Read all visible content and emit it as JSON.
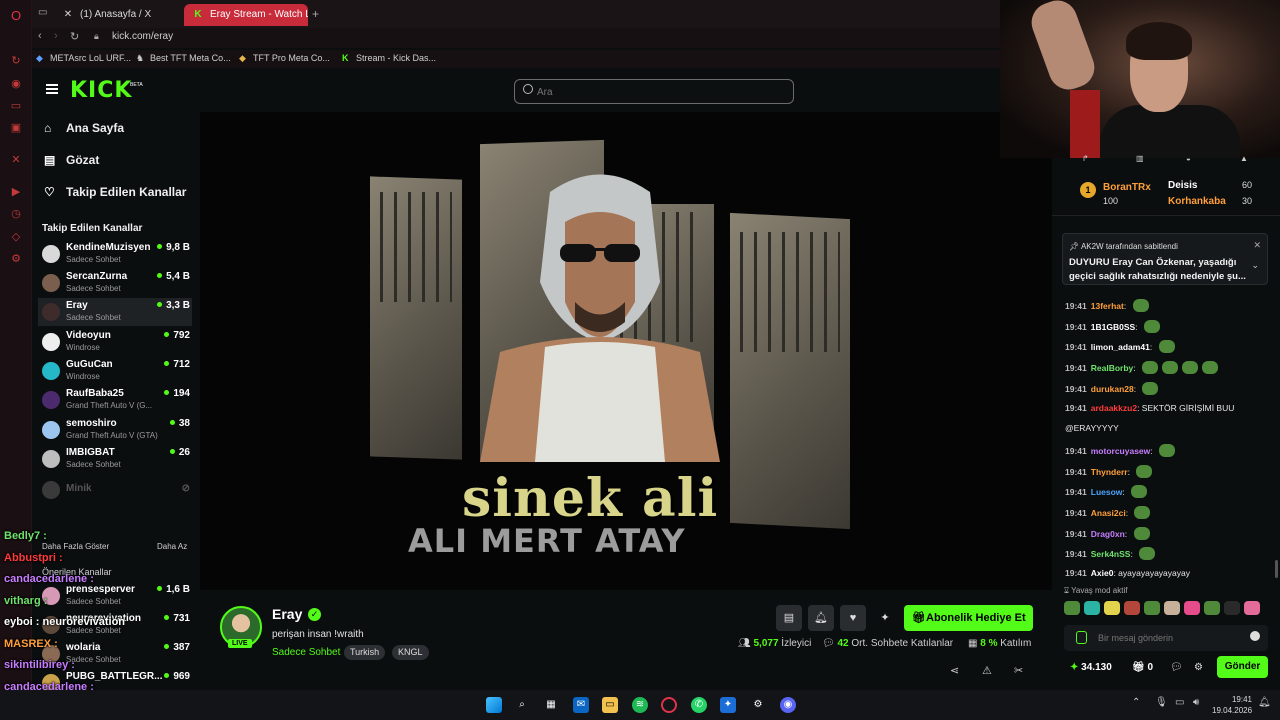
{
  "browser": {
    "tabs": [
      {
        "label": "(1) Anasayfa / X",
        "icon": "x-logo-icon"
      },
      {
        "label": "Eray Stream - Watch L",
        "icon": "kick-logo-icon"
      }
    ],
    "url": "kick.com/eray",
    "bookmarks": [
      "METAsrc LoL URF...",
      "Best TFT Meta Co...",
      "TFT Pro Meta Co...",
      "Stream - Kick Das..."
    ]
  },
  "kick": {
    "logo": "KICK",
    "beta": "BETA",
    "search_placeholder": "Ara",
    "nav": [
      "Ana Sayfa",
      "Gözat",
      "Takip Edilen Kanallar"
    ]
  },
  "sidebar": {
    "followed_title": "Takip Edilen Kanallar",
    "channels": [
      {
        "name": "KendineMuzisyen",
        "category": "Sadece Sohbet",
        "viewers": "9,8 B"
      },
      {
        "name": "SercanZurna",
        "category": "Sadece Sohbet",
        "viewers": "5,4 B"
      },
      {
        "name": "Eray",
        "category": "Sadece Sohbet",
        "viewers": "3,3 B"
      },
      {
        "name": "Videoyun",
        "category": "Windrose",
        "viewers": "792"
      },
      {
        "name": "GuGuCan",
        "category": "Windrose",
        "viewers": "712"
      },
      {
        "name": "RaufBaba25",
        "category": "Grand Theft Auto V (G...",
        "viewers": "194"
      },
      {
        "name": "semoshiro",
        "category": "Grand Theft Auto V (GTA)",
        "viewers": "38"
      },
      {
        "name": "IMBIGBAT",
        "category": "Sadece Sohbet",
        "viewers": "26"
      },
      {
        "name": "Minik",
        "category": "",
        "viewers": ""
      }
    ],
    "show_more": "Daha Fazla Göster",
    "show_less": "Daha Az",
    "recommended_title": "Önerilen Kanallar",
    "recommended": [
      {
        "name": "prensesperver",
        "category": "Sadece Sohbet",
        "viewers": "1,6 B"
      },
      {
        "name": "neurorevivation",
        "category": "Sadece Sohbet",
        "viewers": "731"
      },
      {
        "name": "wolaria",
        "category": "Sadece Sohbet",
        "viewers": "387"
      },
      {
        "name": "PUBG_BATTLEGR...",
        "category": "",
        "viewers": "969"
      }
    ]
  },
  "stream_overlay_chat": [
    {
      "text": "Bedly7 :",
      "color": "#6fe36b"
    },
    {
      "text": "Abbustpri :",
      "color": "#ff3b3b"
    },
    {
      "text": "candacedarlene :",
      "color": "#c77dff"
    },
    {
      "text": "vitharg :",
      "color": "#6fe36b"
    },
    {
      "text": "eyboi : neurorevivation",
      "color": "#ffffff"
    },
    {
      "text": "MASREX :",
      "color": "#ff9f3b"
    },
    {
      "text": "sikintilibirey :",
      "color": "#c77dff"
    },
    {
      "text": "candacedarlene :",
      "color": "#c77dff"
    }
  ],
  "video": {
    "title_line1": "sinek ali",
    "title_line2": "ALI MERT ATAY"
  },
  "stream": {
    "streamer": "Eray",
    "live_badge": "LIVE",
    "title": "perişan insan !wraith",
    "category": "Sadece Sohbet",
    "tags": [
      "Turkish",
      "KNGL"
    ],
    "subscribe_label": "Abonelik Hediye Et",
    "viewers": "5,077",
    "viewers_label": "İzleyici",
    "chatters": "42",
    "chatters_label": "Ort. Sohbete Katılanlar",
    "participation": "8 %",
    "participation_label": "Katılım"
  },
  "chat": {
    "leaderboard": [
      {
        "name": "BoranTRx",
        "score": "100"
      },
      {
        "name": "Deisis",
        "score": "60"
      },
      {
        "name": "Korhankaba",
        "score": "30"
      }
    ],
    "pinned_by": "AK2W tarafından sabitlendi",
    "pinned_text": "DUYURU Eray Can Özkenar, yaşadığı geçici sağlık rahatsızlığı nedeniyle şu...",
    "messages": [
      {
        "time": "19:41",
        "user": "13ferhat",
        "text": "",
        "color": "#ff9f3b",
        "emotes": 1
      },
      {
        "time": "19:41",
        "user": "1B1GB0SS",
        "text": "",
        "color": "#ffffff",
        "emotes": 1
      },
      {
        "time": "19:41",
        "user": "limon_adam41",
        "text": "",
        "color": "#ffffff",
        "emotes": 1
      },
      {
        "time": "19:41",
        "user": "RealBorby",
        "text": "",
        "color": "#6fe36b",
        "emotes": 4
      },
      {
        "time": "19:41",
        "user": "durukan28",
        "text": "",
        "color": "#ff9f3b",
        "emotes": 1
      },
      {
        "time": "19:41",
        "user": "ardaakkzu2",
        "text": "SEKTÖR GİRİŞİMİ BUU",
        "color": "#ff3b3b",
        "emotes": 0
      },
      {
        "time": "",
        "user": "",
        "text": "@ERAYYYYY",
        "color": "#ffffff",
        "emotes": 0
      },
      {
        "time": "19:41",
        "user": "motorcuyasew",
        "text": "",
        "color": "#c77dff",
        "emotes": 1
      },
      {
        "time": "19:41",
        "user": "Thynderr",
        "text": "",
        "color": "#ff9f3b",
        "emotes": 1
      },
      {
        "time": "19:41",
        "user": "Luesow",
        "text": "",
        "color": "#4aa3ff",
        "emotes": 1
      },
      {
        "time": "19:41",
        "user": "Anasi2ci",
        "text": "",
        "color": "#ff9f3b",
        "emotes": 1
      },
      {
        "time": "19:41",
        "user": "Drag0xn",
        "text": "",
        "color": "#c77dff",
        "emotes": 1
      },
      {
        "time": "19:41",
        "user": "Serk4nSS",
        "text": "",
        "color": "#6fe36b",
        "emotes": 1
      },
      {
        "time": "19:41",
        "user": "Axie0",
        "text": "ayayayayayayayay",
        "color": "#ffffff",
        "emotes": 0
      }
    ],
    "slow_mode": "Yavaş mod aktif",
    "input_placeholder": "Bir mesaj gönderin",
    "points": "34.130",
    "gifts": "0",
    "send_label": "Gönder"
  },
  "taskbar": {
    "time": "19:41",
    "date": "19.04.2026"
  }
}
